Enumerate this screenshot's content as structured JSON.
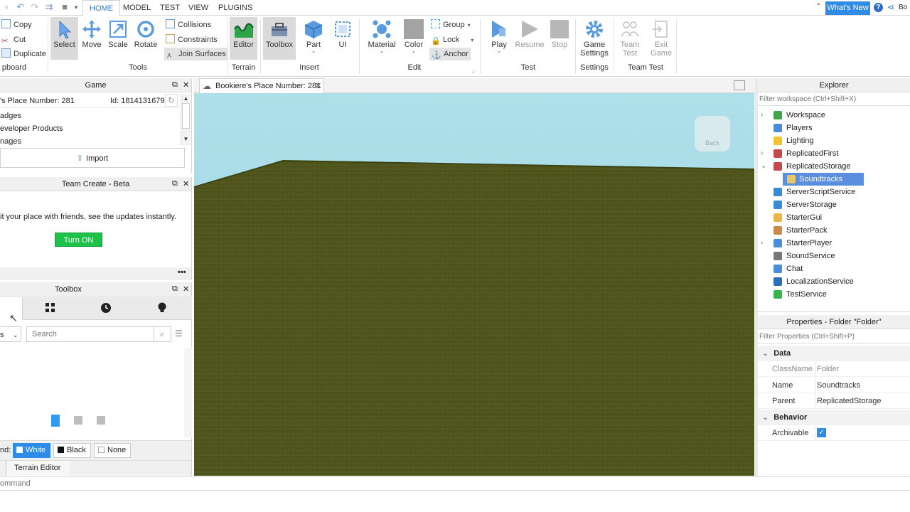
{
  "menu": {
    "tabs": [
      "HOME",
      "MODEL",
      "TEST",
      "VIEW",
      "PLUGINS"
    ],
    "active": "HOME",
    "whats_new": "What's New",
    "user_abbrev": "Bo"
  },
  "ribbon": {
    "clipboard": {
      "copy": "Copy",
      "cut": "Cut",
      "duplicate": "Duplicate",
      "label": "pboard"
    },
    "tools": {
      "select": "Select",
      "move": "Move",
      "scale": "Scale",
      "rotate": "Rotate",
      "collisions": "Collisions",
      "constraints": "Constraints",
      "join_surfaces": "Join Surfaces",
      "label": "Tools"
    },
    "terrain": {
      "editor": "Editor",
      "label": "Terrain"
    },
    "insert": {
      "toolbox": "Toolbox",
      "part": "Part",
      "ui": "UI",
      "label": "Insert"
    },
    "edit": {
      "material": "Material",
      "color": "Color",
      "group": "Group",
      "lock": "Lock",
      "anchor": "Anchor",
      "label": "Edit"
    },
    "test": {
      "play": "Play",
      "resume": "Resume",
      "stop": "Stop",
      "label": "Test"
    },
    "settings": {
      "game_settings_1": "Game",
      "game_settings_2": "Settings",
      "label": "Settings"
    },
    "team_test": {
      "team_test_1": "Team",
      "team_test_2": "Test",
      "exit_game_1": "Exit",
      "exit_game_2": "Game",
      "label": "Team Test"
    }
  },
  "game_panel": {
    "title": "Game",
    "place": "'s Place Number: 281",
    "id": "Id: 1814131679",
    "items": [
      "adges",
      "eveloper Products",
      "nages"
    ],
    "import": "Import"
  },
  "team_create": {
    "title": "Team Create - Beta",
    "text": "it your place with friends, see the updates instantly.",
    "button": "Turn ON"
  },
  "toolbox": {
    "title": "Toolbox",
    "dropdown": "s",
    "search_placeholder": "Search",
    "bg_label": "nd:",
    "bg_white": "White",
    "bg_black": "Black",
    "bg_none": "None"
  },
  "bottom_tabs": {
    "terrain_editor": "Terrain Editor"
  },
  "command_bar": {
    "placeholder": "ommand"
  },
  "viewport": {
    "tab_title": "Bookiere's Place Number: 281",
    "view_cube_label": "Back"
  },
  "explorer": {
    "title": "Explorer",
    "filter_placeholder": "Filter workspace (Ctrl+Shift+X)",
    "items": [
      {
        "label": "Workspace",
        "arrow": "›",
        "color": "#3fa54a"
      },
      {
        "label": "Players",
        "arrow": "",
        "color": "#4a8fd6"
      },
      {
        "label": "Lighting",
        "arrow": "",
        "color": "#f2c230"
      },
      {
        "label": "ReplicatedFirst",
        "arrow": "›",
        "color": "#c24a4a"
      },
      {
        "label": "ReplicatedStorage",
        "arrow": "⌄",
        "color": "#c24a4a"
      },
      {
        "label": "Soundtracks",
        "arrow": "",
        "color": "#e8c56a"
      },
      {
        "label": "ServerScriptService",
        "arrow": "",
        "color": "#3a8ad4"
      },
      {
        "label": "ServerStorage",
        "arrow": "",
        "color": "#3a8ad4"
      },
      {
        "label": "StarterGui",
        "arrow": "",
        "color": "#e8b64a"
      },
      {
        "label": "StarterPack",
        "arrow": "",
        "color": "#c9894a"
      },
      {
        "label": "StarterPlayer",
        "arrow": "›",
        "color": "#4a8fd6"
      },
      {
        "label": "SoundService",
        "arrow": "",
        "color": "#777777"
      },
      {
        "label": "Chat",
        "arrow": "",
        "color": "#4a8fd6"
      },
      {
        "label": "LocalizationService",
        "arrow": "",
        "color": "#2a6fb8"
      },
      {
        "label": "TestService",
        "arrow": "",
        "color": "#36b34a"
      }
    ],
    "selected": "Soundtracks"
  },
  "properties": {
    "title": "Properties - Folder \"Folder\"",
    "filter_placeholder": "Filter Properties (Ctrl+Shift+P)",
    "cat_data": "Data",
    "classname_k": "ClassName",
    "classname_v": "Folder",
    "name_k": "Name",
    "name_v": "Soundtracks",
    "parent_k": "Parent",
    "parent_v": "ReplicatedStorage",
    "cat_behavior": "Behavior",
    "archivable_k": "Archivable",
    "archivable_v": true
  },
  "colors": {
    "accent": "#2e8be6",
    "turn_on": "#1ec24a",
    "selection": "#cfe3fb",
    "sky": "#b3dde3",
    "grass": "#50561f"
  }
}
